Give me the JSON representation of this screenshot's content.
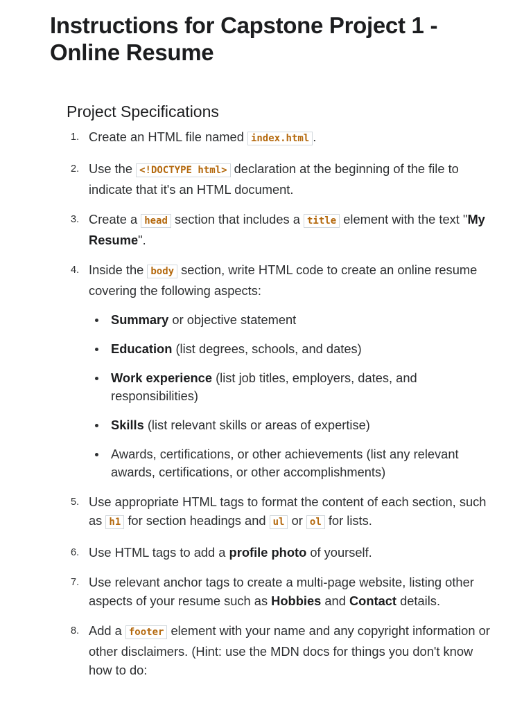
{
  "title": "Instructions for Capstone Project 1 - Online Resume",
  "section_heading": "Project Specifications",
  "steps": [
    {
      "num": "1.",
      "t1": "Create an HTML file named ",
      "c1": "index.html",
      "t2": "."
    },
    {
      "num": "2.",
      "t1": "Use the ",
      "c1": "<!DOCTYPE html>",
      "t2": " declaration at the beginning of the file to indicate that it's an HTML document."
    },
    {
      "num": "3.",
      "t1": "Create a ",
      "c1": "head",
      "t2": " section that includes a ",
      "c2": "title",
      "t3": " element with the text \"",
      "b1": "My Resume",
      "t4": "\"."
    },
    {
      "num": "4.",
      "t1": "Inside the ",
      "c1": "body",
      "t2": " section, write HTML code to create an online resume covering the following aspects:",
      "bullets": [
        {
          "bold": "Summary",
          "text": " or objective statement"
        },
        {
          "bold": "Education",
          "text": " (list degrees, schools, and dates)"
        },
        {
          "bold": "Work experience",
          "text": " (list job titles, employers, dates, and responsibilities)"
        },
        {
          "bold": "Skills",
          "text": " (list relevant skills or areas of expertise)"
        },
        {
          "bold": "",
          "text": "Awards, certifications, or other achievements (list any relevant awards, certifications, or other accomplishments)"
        }
      ]
    },
    {
      "num": "5.",
      "t1": "Use appropriate HTML tags to format the content of each section, such as ",
      "c1": "h1",
      "t2": " for section headings and ",
      "c2": "ul",
      "t3": " or ",
      "c3": "ol",
      "t4": " for lists."
    },
    {
      "num": "6.",
      "t1": "Use HTML tags to add a ",
      "b1": "profile photo",
      "t2": " of yourself."
    },
    {
      "num": "7.",
      "t1": "Use relevant anchor tags to create a multi-page website, listing other aspects of your resume such as ",
      "b1": "Hobbies",
      "t2": " and ",
      "b2": "Contact",
      "t3": " details."
    },
    {
      "num": "8.",
      "t1": "Add a ",
      "c1": "footer",
      "t2": " element with your name and any copyright information or other disclaimers. (Hint: use the MDN docs for things you don't know how to do:"
    }
  ]
}
